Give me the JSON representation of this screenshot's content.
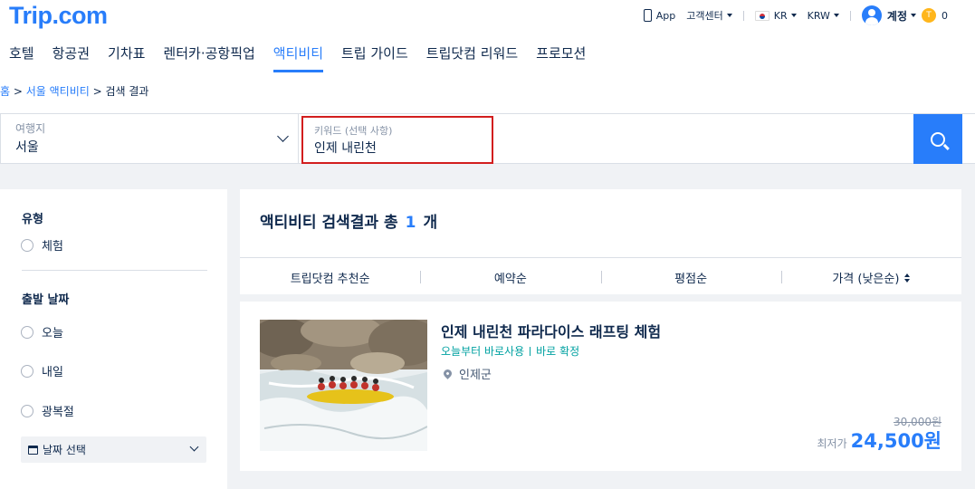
{
  "header": {
    "logo": "Trip.com",
    "app_label": "App",
    "support_label": "고객센터",
    "language": "KR",
    "currency": "KRW",
    "account_label": "계정",
    "coins": "0",
    "coin_symbol": "T"
  },
  "nav": {
    "tabs": [
      {
        "label": "호텔"
      },
      {
        "label": "항공권"
      },
      {
        "label": "기차표"
      },
      {
        "label": "렌터카·공항픽업"
      },
      {
        "label": "액티비티"
      },
      {
        "label": "트립 가이드"
      },
      {
        "label": "트립닷컴 리워드"
      },
      {
        "label": "프로모션"
      }
    ],
    "active": "액티비티"
  },
  "breadcrumb": {
    "home": "홈",
    "sep1": " > ",
    "city": "서울 액티비티",
    "sep2": " > ",
    "current": "검색 결과"
  },
  "search": {
    "destination_label": "여행지",
    "destination_value": "서울",
    "keyword_label": "키워드 (선택 사항)",
    "keyword_value": "인제 내린천"
  },
  "filters": {
    "type_heading": "유형",
    "type_options": [
      "체험"
    ],
    "date_heading": "출발 날짜",
    "date_options": [
      "오늘",
      "내일",
      "광복절"
    ],
    "date_select_label": "날짜 선택"
  },
  "results": {
    "title_prefix": "액티비티 검색결과 총",
    "count": "1",
    "title_suffix": "개",
    "sort": [
      "트립닷컴 추천순",
      "예약순",
      "평점순",
      "가격 (낮은순)"
    ]
  },
  "product": {
    "title": "인제 내린천 파라다이스 래프팅 체험",
    "tag1": "오늘부터 바로사용",
    "tag2": "바로 확정",
    "location": "인제군",
    "original_price": "30,000원",
    "price_label": "최저가",
    "price": "24,500원"
  },
  "colors": {
    "brand": "#287dfa",
    "keyword_highlight": "#d21e1e",
    "tag": "#00a1a1"
  }
}
